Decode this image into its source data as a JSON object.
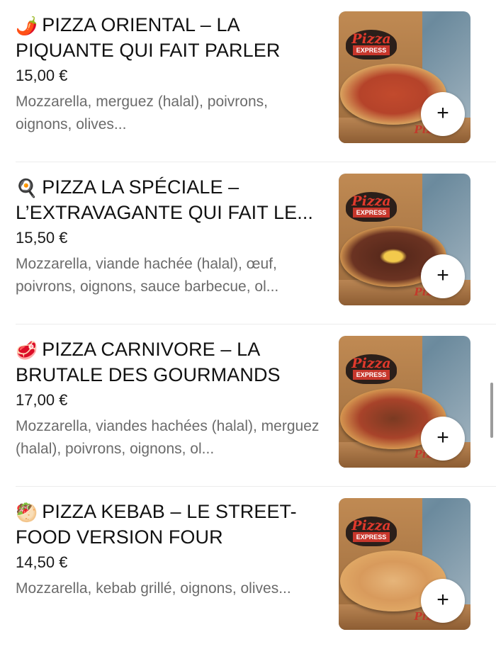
{
  "items": [
    {
      "emoji": "🌶️",
      "emoji_icon": "chili-pepper-icon",
      "title": "PIZZA ORIENTAL – LA PIQUANTE QUI FAIT PARLER",
      "price": "15,00 €",
      "description": "Mozzarella, merguez (halal), poivrons, oignons, olives...",
      "add_label": "+"
    },
    {
      "emoji": "🍳",
      "emoji_icon": "fried-egg-icon",
      "title": "PIZZA LA SPÉCIALE – L’EXTRAVAGANTE QUI FAIT LE...",
      "price": "15,50 €",
      "description": "Mozzarella, viande hachée (halal), œuf, poivrons, oignons, sauce barbecue, ol...",
      "add_label": "+"
    },
    {
      "emoji": "🥩",
      "emoji_icon": "meat-cut-icon",
      "title": "PIZZA CARNIVORE – LA BRUTALE DES GOURMANDS",
      "price": "17,00 €",
      "description": "Mozzarella, viandes hachées (halal), merguez (halal), poivrons, oignons, ol...",
      "add_label": "+"
    },
    {
      "emoji": "🥙",
      "emoji_icon": "kebab-icon",
      "title": "PIZZA KEBAB – LE STREET-FOOD VERSION FOUR",
      "price": "14,50 €",
      "description": "Mozzarella, kebab grillé, oignons, olives...",
      "add_label": "+"
    }
  ],
  "thumbnail": {
    "logo_word": "Pizza",
    "logo_banner": "EXPRESS",
    "box_stamp": "Piz"
  }
}
